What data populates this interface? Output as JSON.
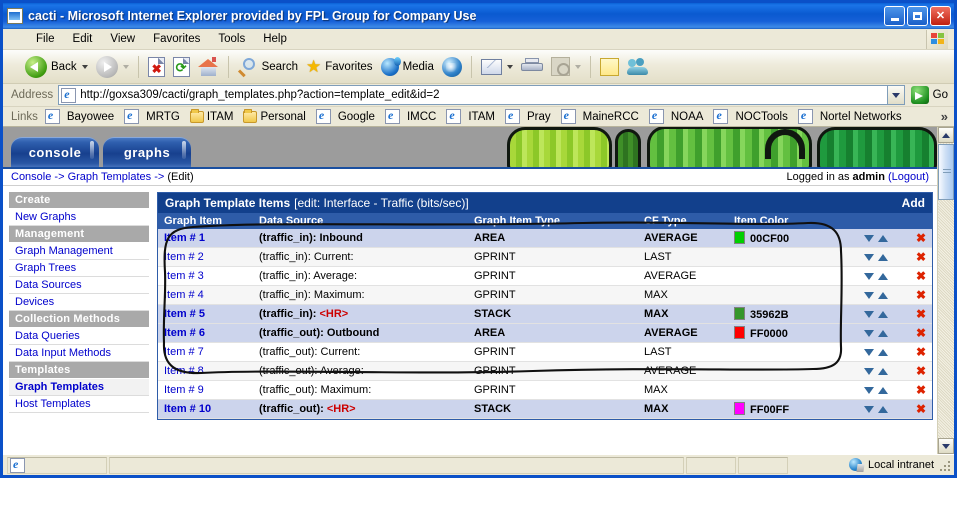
{
  "window": {
    "title": "cacti - Microsoft Internet Explorer provided by FPL Group for Company Use",
    "minimize_label": "Minimize",
    "maximize_label": "Maximize",
    "close_label": "Close"
  },
  "menubar": {
    "items": [
      "File",
      "Edit",
      "View",
      "Favorites",
      "Tools",
      "Help"
    ]
  },
  "toolbar": {
    "back_label": "Back",
    "forward_label": "Forward",
    "stop_label": "Stop",
    "refresh_label": "Refresh",
    "home_label": "Home",
    "search_label": "Search",
    "favorites_label": "Favorites",
    "media_label": "Media",
    "history_label": "History",
    "mail_label": "Mail",
    "print_label": "Print",
    "edit_label": "Edit",
    "discuss_label": "Discuss",
    "messenger_label": "Messenger"
  },
  "address": {
    "label": "Address",
    "url": "http://goxsa309/cacti/graph_templates.php?action=template_edit&id=2",
    "go_label": "Go"
  },
  "links": {
    "label": "Links",
    "items": [
      {
        "label": "Bayowee",
        "icon": "ie-page-icon"
      },
      {
        "label": "MRTG",
        "icon": "ie-page-icon"
      },
      {
        "label": "ITAM",
        "icon": "folder-icon"
      },
      {
        "label": "Personal",
        "icon": "folder-icon"
      },
      {
        "label": "Google",
        "icon": "ie-page-icon"
      },
      {
        "label": "IMCC",
        "icon": "ie-page-icon"
      },
      {
        "label": "ITAM",
        "icon": "ie-page-icon"
      },
      {
        "label": "Pray",
        "icon": "ie-page-icon"
      },
      {
        "label": "MaineRCC",
        "icon": "ie-page-icon"
      },
      {
        "label": "NOAA",
        "icon": "ie-page-icon"
      },
      {
        "label": "NOCTools",
        "icon": "ie-page-icon"
      },
      {
        "label": "Nortel Networks",
        "icon": "ie-page-icon"
      }
    ],
    "overflow": "»"
  },
  "cacti": {
    "tabs": [
      {
        "label": "console",
        "active": true
      },
      {
        "label": "graphs",
        "active": false
      }
    ],
    "breadcrumb": {
      "console": "Console",
      "sep1": " -> ",
      "graph_templates": "Graph Templates",
      "sep2": " -> ",
      "current": "(Edit)"
    },
    "session": {
      "prefix": "Logged in as ",
      "user": "admin",
      "logout": "(Logout)"
    }
  },
  "sidebar": {
    "sections": [
      {
        "header": "Create",
        "items": [
          {
            "label": "New Graphs",
            "active": false
          }
        ]
      },
      {
        "header": "Management",
        "items": [
          {
            "label": "Graph Management",
            "active": false
          },
          {
            "label": "Graph Trees",
            "active": false
          },
          {
            "label": "Data Sources",
            "active": false
          },
          {
            "label": "Devices",
            "active": false
          }
        ]
      },
      {
        "header": "Collection Methods",
        "items": [
          {
            "label": "Data Queries",
            "active": false
          },
          {
            "label": "Data Input Methods",
            "active": false
          }
        ]
      },
      {
        "header": "Templates",
        "items": [
          {
            "label": "Graph Templates",
            "active": true
          },
          {
            "label": "Host Templates",
            "active": false
          }
        ]
      }
    ]
  },
  "main": {
    "panel_title": "Graph Template Items",
    "panel_subtitle": "[edit: Interface - Traffic (bits/sec)]",
    "add_label": "Add",
    "columns": [
      "Graph Item",
      "Data Source",
      "Graph Item Type",
      "CF Type",
      "Item Color",
      ""
    ],
    "rows": [
      {
        "item": "Item # 1",
        "data_source_prefix": "(traffic_in): ",
        "data_source_suffix": "Inbound",
        "is_hr": false,
        "graph_item_type": "AREA",
        "cf_type": "AVERAGE",
        "color_hex": "00CF00",
        "color_label": "00CF00",
        "highlight": true
      },
      {
        "item": "Item # 2",
        "data_source_prefix": "(traffic_in): ",
        "data_source_suffix": "Current:",
        "is_hr": false,
        "graph_item_type": "GPRINT",
        "cf_type": "LAST",
        "color_hex": "",
        "color_label": "",
        "highlight": false
      },
      {
        "item": "Item # 3",
        "data_source_prefix": "(traffic_in): ",
        "data_source_suffix": "Average:",
        "is_hr": false,
        "graph_item_type": "GPRINT",
        "cf_type": "AVERAGE",
        "color_hex": "",
        "color_label": "",
        "highlight": false
      },
      {
        "item": "Item # 4",
        "data_source_prefix": "(traffic_in): ",
        "data_source_suffix": "Maximum:",
        "is_hr": false,
        "graph_item_type": "GPRINT",
        "cf_type": "MAX",
        "color_hex": "",
        "color_label": "",
        "highlight": false
      },
      {
        "item": "Item # 5",
        "data_source_prefix": "(traffic_in): ",
        "data_source_suffix": "<HR>",
        "is_hr": true,
        "graph_item_type": "STACK",
        "cf_type": "MAX",
        "color_hex": "35962B",
        "color_label": "35962B",
        "highlight": true
      },
      {
        "item": "Item # 6",
        "data_source_prefix": "(traffic_out): ",
        "data_source_suffix": "Outbound",
        "is_hr": false,
        "graph_item_type": "AREA",
        "cf_type": "AVERAGE",
        "color_hex": "FF0000",
        "color_label": "FF0000",
        "highlight": true
      },
      {
        "item": "Item # 7",
        "data_source_prefix": "(traffic_out): ",
        "data_source_suffix": "Current:",
        "is_hr": false,
        "graph_item_type": "GPRINT",
        "cf_type": "LAST",
        "color_hex": "",
        "color_label": "",
        "highlight": false
      },
      {
        "item": "Item # 8",
        "data_source_prefix": "(traffic_out): ",
        "data_source_suffix": "Average:",
        "is_hr": false,
        "graph_item_type": "GPRINT",
        "cf_type": "AVERAGE",
        "color_hex": "",
        "color_label": "",
        "highlight": false
      },
      {
        "item": "Item # 9",
        "data_source_prefix": "(traffic_out): ",
        "data_source_suffix": "Maximum:",
        "is_hr": false,
        "graph_item_type": "GPRINT",
        "cf_type": "MAX",
        "color_hex": "",
        "color_label": "",
        "highlight": false
      },
      {
        "item": "Item # 10",
        "data_source_prefix": "(traffic_out): ",
        "data_source_suffix": "<HR>",
        "is_hr": true,
        "graph_item_type": "STACK",
        "cf_type": "MAX",
        "color_hex": "FF00FF",
        "color_label": "FF00FF",
        "highlight": true
      }
    ]
  },
  "statusbar": {
    "zone_label": "Local intranet"
  },
  "colors": {
    "titlebar_blue": "#0A50C8",
    "panel_header": "#12408C",
    "table_header": "#2E5CA8",
    "link_blue": "#0000CC",
    "hr_red": "#CC0000",
    "highlight_row": "#CCD4EC"
  }
}
